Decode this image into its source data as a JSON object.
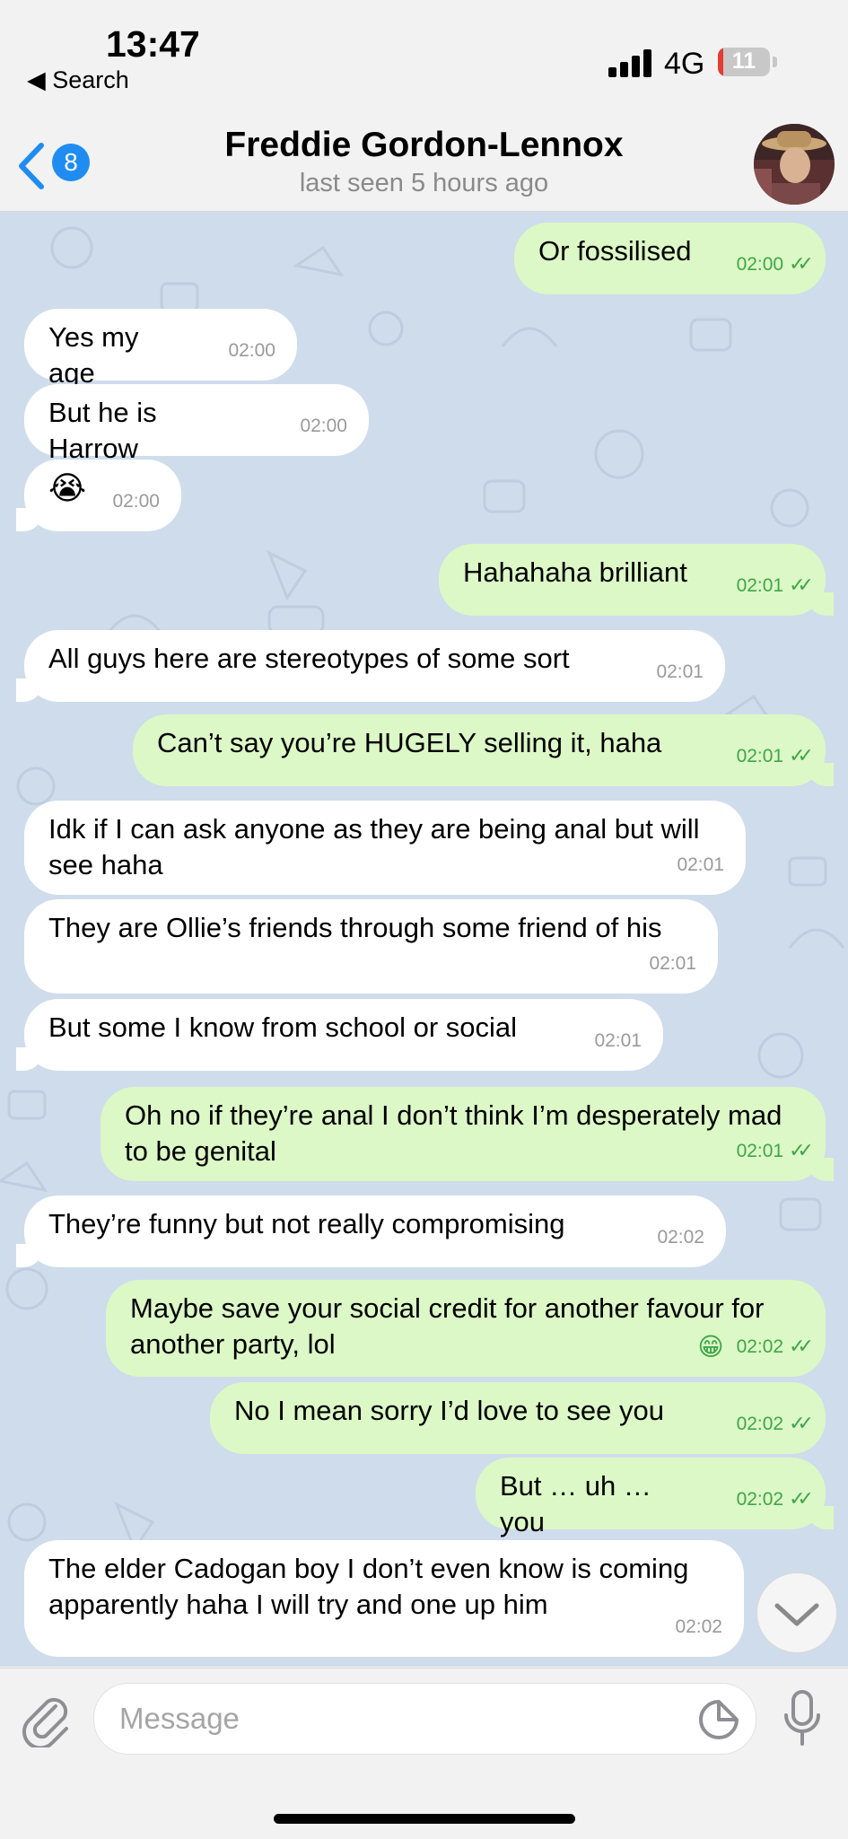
{
  "status_bar": {
    "time": "13:47",
    "back_app": "◀ Search",
    "network": "4G",
    "battery": "11",
    "battery_level": 0.11
  },
  "header": {
    "unread_count": "8",
    "title": "Freddie Gordon-Lennox",
    "subtitle": "last seen 5 hours ago"
  },
  "messages": [
    {
      "dir": "out",
      "text": "Or fossilised",
      "time": "02:00"
    },
    {
      "dir": "in",
      "text": "Yes my age",
      "time": "02:00"
    },
    {
      "dir": "in",
      "text": "But he is Harrow",
      "time": "02:00"
    },
    {
      "dir": "in",
      "text": "😭",
      "time": "02:00"
    },
    {
      "dir": "out",
      "text": "Hahahaha brilliant",
      "time": "02:01"
    },
    {
      "dir": "in",
      "text": "All guys here are stereotypes of some sort",
      "time": "02:01"
    },
    {
      "dir": "out",
      "text": "Can’t say you’re HUGELY selling it, haha",
      "time": "02:01"
    },
    {
      "dir": "in",
      "text": "Idk if I can ask anyone as they are being anal but will see haha",
      "time": "02:01"
    },
    {
      "dir": "in",
      "text": "They are Ollie’s friends through some friend of his",
      "time": "02:01"
    },
    {
      "dir": "in",
      "text": "But some I know from school or social",
      "time": "02:01"
    },
    {
      "dir": "out",
      "text": "Oh no if they’re anal I don’t think I’m desperately mad to be genital",
      "time": "02:01"
    },
    {
      "dir": "in",
      "text": "They’re funny but not really compromising",
      "time": "02:02"
    },
    {
      "dir": "out",
      "text": "Maybe save your social credit for another favour for another party, lol",
      "time": "02:02",
      "reaction": "😁"
    },
    {
      "dir": "out",
      "text": "No I mean sorry I’d love to see you",
      "time": "02:02"
    },
    {
      "dir": "out",
      "text": "But … uh … you",
      "time": "02:02"
    },
    {
      "dir": "in",
      "text": "The elder Cadogan boy I don’t even know is coming apparently haha I will try and one up him",
      "time": "02:02"
    }
  ],
  "composer": {
    "placeholder": "Message"
  },
  "colors": {
    "accent": "#1f8cf2",
    "outgoing_bubble": "#dcf8c6",
    "incoming_bubble": "#ffffff",
    "chat_background": "#cfdceb",
    "read_check": "#3fa64a"
  },
  "icons": {
    "back": "chevron-left-icon",
    "attach": "paperclip-icon",
    "sticker": "sticker-icon",
    "voice": "microphone-icon",
    "scroll": "chevron-down-icon"
  }
}
